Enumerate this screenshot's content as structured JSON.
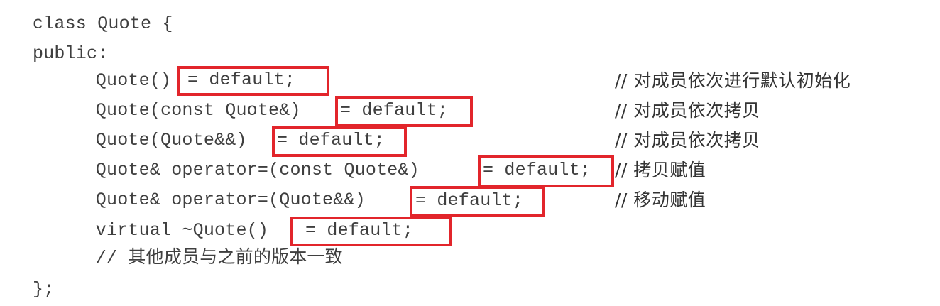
{
  "code": {
    "lines": [
      "class Quote {",
      "public:",
      "    Quote()",
      "    Quote(const Quote&)",
      "    Quote(Quote&&)",
      "    Quote& operator=(const Quote&)",
      "    Quote& operator=(Quote&&)",
      "    virtual ~Quote()",
      "    // 其他成员与之前的版本一致",
      "};"
    ],
    "defaults": [
      "= default;",
      "= default;",
      "= default;",
      "= default;",
      "= default;",
      "= default;"
    ],
    "comments": [
      "// 对成员依次进行默认初始化",
      "// 对成员依次拷贝",
      "// 对成员依次拷贝",
      "// 拷贝赋值",
      "// 移动赋值"
    ]
  },
  "colors": {
    "highlight_border": "#e2252b",
    "text": "#3f3f3f",
    "background": "#ffffff"
  }
}
